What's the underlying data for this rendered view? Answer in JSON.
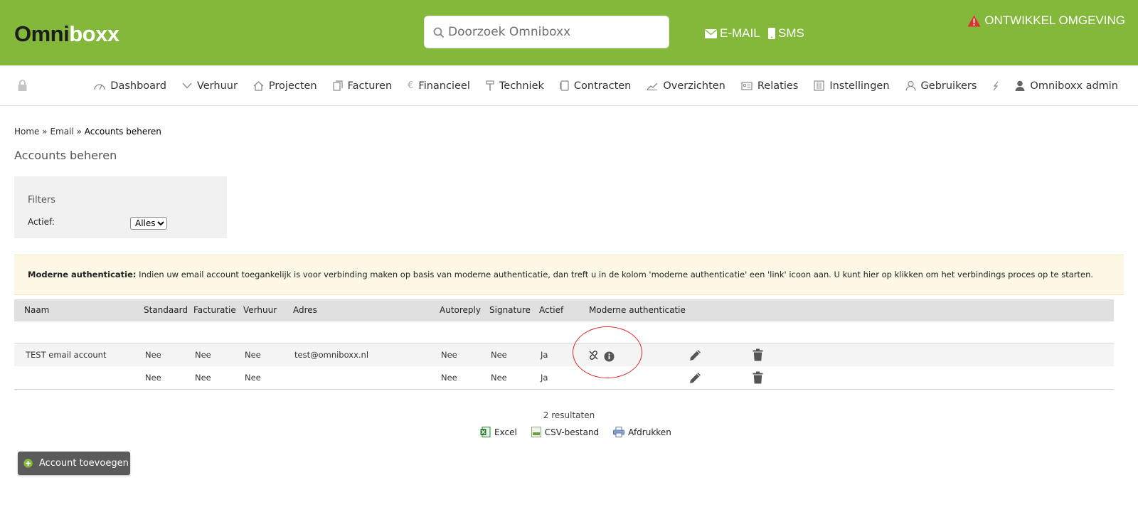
{
  "header": {
    "logo_dark": "Omni",
    "logo_light": "boxx",
    "search_placeholder": "Doorzoek Omniboxx",
    "email_label": "E-MAIL",
    "sms_label": "SMS",
    "env_warning": "ONTWIKKEL OMGEVING"
  },
  "nav": {
    "items": [
      {
        "label": "Dashboard",
        "icon": "dashboard-icon"
      },
      {
        "label": "Verhuur",
        "icon": "chevron-down-icon"
      },
      {
        "label": "Projecten",
        "icon": "home-icon"
      },
      {
        "label": "Facturen",
        "icon": "documents-icon"
      },
      {
        "label": "Financieel",
        "icon": "euro-icon"
      },
      {
        "label": "Techniek",
        "icon": "hammer-icon"
      },
      {
        "label": "Contracten",
        "icon": "contract-icon"
      },
      {
        "label": "Overzichten",
        "icon": "trend-icon"
      },
      {
        "label": "Relaties",
        "icon": "id-card-icon"
      },
      {
        "label": "Instellingen",
        "icon": "sliders-icon"
      },
      {
        "label": "Gebruikers",
        "icon": "user-outline-icon"
      },
      {
        "label": "",
        "icon": "lightning-icon"
      },
      {
        "label": "Omniboxx admin",
        "icon": "user-icon"
      }
    ]
  },
  "breadcrumb": {
    "home": "Home",
    "sep": "»",
    "email": "Email",
    "current": "Accounts beheren"
  },
  "page_title": "Accounts beheren",
  "filters": {
    "title": "Filters",
    "actief_label": "Actief:",
    "actief_value": "Alles"
  },
  "notice": {
    "bold": "Moderne authenticatie:",
    "text": " Indien uw email account toegankelijk is voor verbinding maken op basis van moderne authenticatie, dan treft u in de kolom 'moderne authenticatie' een 'link' icoon aan. U kunt hier op klikken om het verbindings proces op te starten."
  },
  "table": {
    "columns": [
      "Naam",
      "Standaard",
      "Facturatie",
      "Verhuur",
      "Adres",
      "Autoreply",
      "Signature",
      "Actief",
      "Moderne authenticatie"
    ],
    "rows": [
      {
        "naam": "TEST email account",
        "standaard": "Nee",
        "facturatie": "Nee",
        "verhuur": "Nee",
        "adres": "test@omniboxx.nl",
        "autoreply": "Nee",
        "signature": "Nee",
        "actief": "Ja",
        "modern_auth": true
      },
      {
        "naam": "",
        "standaard": "Nee",
        "facturatie": "Nee",
        "verhuur": "Nee",
        "adres": "",
        "autoreply": "Nee",
        "signature": "Nee",
        "actief": "Ja",
        "modern_auth": false
      }
    ]
  },
  "results": "2 resultaten",
  "exports": {
    "excel": "Excel",
    "csv": "CSV-bestand",
    "print": "Afdrukken"
  },
  "add_button": "Account toevoegen",
  "colors": {
    "header_green": "#83b83a",
    "warning_red": "#d9342b",
    "notice_bg": "#fdf8e5",
    "button_gray": "#5b5b5b",
    "highlight_circle": "#e02a2a"
  }
}
